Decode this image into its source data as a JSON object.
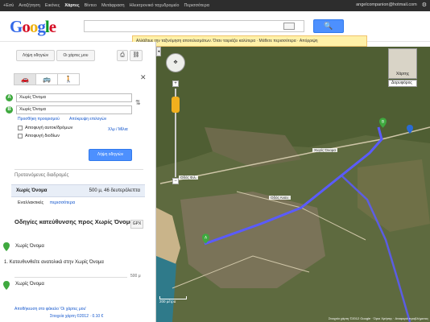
{
  "topbar": {
    "items": [
      "+Εσύ",
      "Αναζήτηση",
      "Εικόνες",
      "Χάρτες",
      "Βίντεο",
      "Μετάφραση",
      "Ηλεκτρονικό ταχυδρομείο",
      "Περισσότερα"
    ],
    "active_index": 3,
    "user_email": "angelcompanion@hotmail.com",
    "gear_icon": "gear-icon"
  },
  "header": {
    "logo_text": "Google",
    "search_value": "",
    "search_button_label": "🔍",
    "notice": "Αλλάξαμε την ταξινόμηση αποτελεσμάτων. Όταν ταιριάζει καλύτερα · Μάθετε περισσότερα · Απόρριψη"
  },
  "panel": {
    "buttons": {
      "directions": "Λήψη οδηγιών",
      "my_places": "Οι χάρτες μου",
      "print_icon": "print-icon",
      "link_icon": "link-icon"
    },
    "modes": [
      "🚗",
      "🚌",
      "🚶"
    ],
    "selected_mode": 0,
    "close_icon": "close-icon",
    "from_marker": "A",
    "from_value": "Χωρίς Όνομα",
    "to_marker": "B",
    "to_value": "Χωρίς Όνομα",
    "add_destination": "Προσθήκη προορισμού",
    "show_options": "Απόκρυψη επιλογών",
    "avoid_highways": "Αποφυγή αυτοκ/δρόμων",
    "avoid_tolls": "Αποφυγή διοδίων",
    "units": "Χλμ / Μίλια",
    "get_directions_button": "Λήψη οδηγιών",
    "suggested_title": "Προτεινόμενες διαδρομές",
    "route1_name": "Χωρίς Όνομα",
    "route1_detail": "500 μ, 46 δευτερόλεπτα",
    "route2_name": "Εναλλακτικές",
    "route2_link": "περισσότερα",
    "directions_title": "Οδηγίες κατεύθυνσης προς Χωρίς Όνομα",
    "gpx_button": "GPX",
    "start_label": "Χωρίς Όνομα",
    "step1": "1. Κατευθυνθείτε ανατολικά στην Χωρίς Όνομα",
    "step1_distance": "500 μ",
    "end_label": "Χωρίς Όνομα",
    "footer_link": "Αποθήκευση στο φάκελο 'Οι χάρτες μου'",
    "footer_note": "Στοιχεία χάρτη ©2012 · 0.10 €"
  },
  "map": {
    "street_labels": [
      "Οδός Φιλ.",
      "Χωρίς Όνομα",
      "Οδός Αναν."
    ],
    "map_type": "Χάρτης",
    "map_dropdown": "Δορυφόρος",
    "scale": "200 μέτρα",
    "attribution": "Στοιχεία χάρτη ©2012 Google · Όροι Χρήσης · Αναφορά προβλήματος",
    "route_color": "#5a5bff",
    "pin_A_color": "#3fa93f",
    "pin_B_color": "#2a6bd6"
  }
}
